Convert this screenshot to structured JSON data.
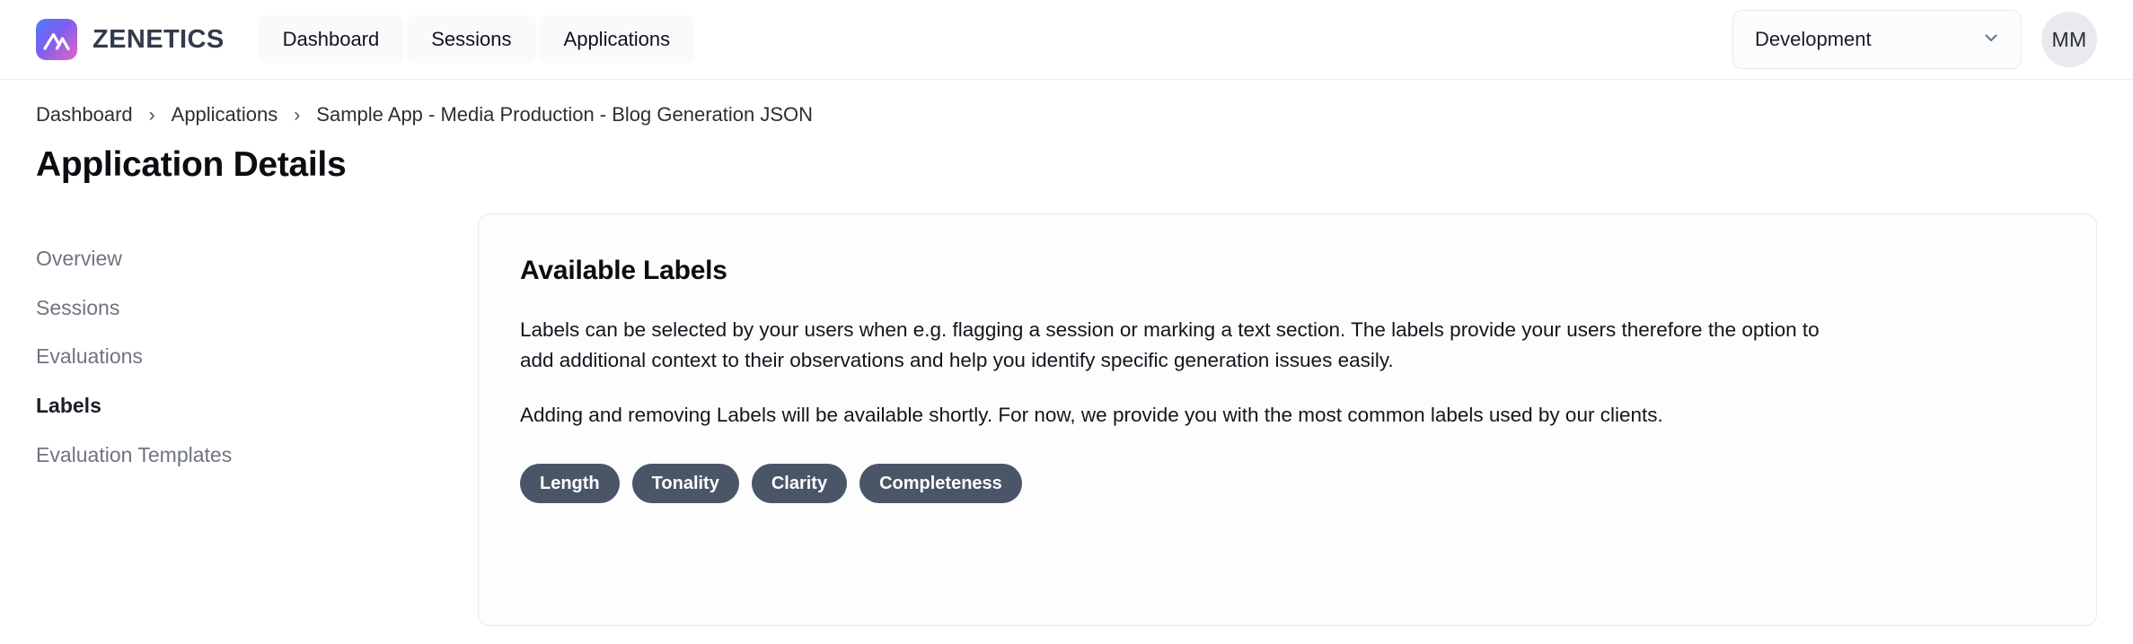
{
  "header": {
    "brand_name": "ZENETICS",
    "logo_icon": "mountain-logo-icon",
    "nav": [
      {
        "label": "Dashboard"
      },
      {
        "label": "Sessions"
      },
      {
        "label": "Applications"
      }
    ],
    "environment_select": {
      "value": "Development",
      "chevron_icon": "chevron-down-icon"
    },
    "avatar_initials": "MM"
  },
  "breadcrumb": {
    "separator": "›",
    "items": [
      {
        "label": "Dashboard"
      },
      {
        "label": "Applications"
      },
      {
        "label": "Sample App - Media Production - Blog Generation JSON"
      }
    ]
  },
  "page": {
    "title": "Application Details"
  },
  "sidebar": {
    "items": [
      {
        "label": "Overview",
        "active": false
      },
      {
        "label": "Sessions",
        "active": false
      },
      {
        "label": "Evaluations",
        "active": false
      },
      {
        "label": "Labels",
        "active": true
      },
      {
        "label": "Evaluation Templates",
        "active": false
      }
    ]
  },
  "main": {
    "card_title": "Available Labels",
    "paragraph_1": "Labels can be selected by your users when e.g. flagging a session or marking a text section. The labels provide your users therefore the option to add additional context to their observations and help you identify specific generation issues easily.",
    "paragraph_2": "Adding and removing Labels will be available shortly. For now, we provide you with the most common labels used by our clients.",
    "labels": [
      {
        "label": "Length"
      },
      {
        "label": "Tonality"
      },
      {
        "label": "Clarity"
      },
      {
        "label": "Completeness"
      }
    ]
  },
  "colors": {
    "brand_gradient_start": "#4f7dfb",
    "brand_gradient_mid": "#7c5ff0",
    "brand_gradient_end": "#e663c6",
    "brand_text": "#323b4b",
    "chip_bg": "#4a5568",
    "card_border": "#e8eaee",
    "sidebar_inactive": "#6f7480",
    "sidebar_active": "#1b1e25"
  }
}
